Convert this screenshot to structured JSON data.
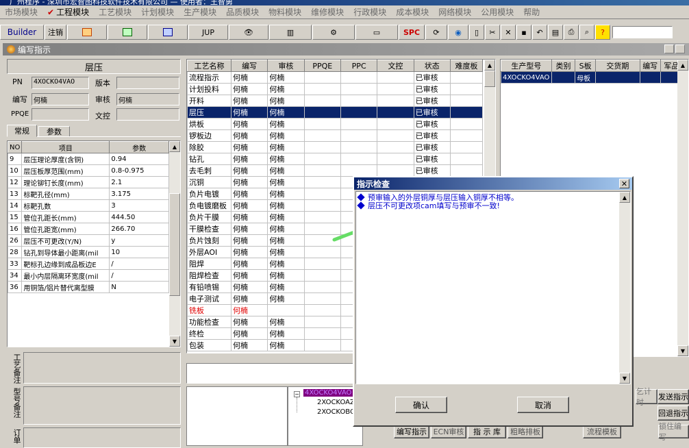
{
  "window_title": "广州程序 - 深圳市宏智图科技软件技术有限公司 — 使用者：王智勇",
  "menu": [
    {
      "label": "市场模块",
      "active": false
    },
    {
      "label": "工程模块",
      "active": true
    },
    {
      "label": "工艺模块",
      "active": false
    },
    {
      "label": "计划模块",
      "active": false
    },
    {
      "label": "生产模块",
      "active": false
    },
    {
      "label": "品质模块",
      "active": false
    },
    {
      "label": "物料模块",
      "active": false
    },
    {
      "label": "维修模块",
      "active": false
    },
    {
      "label": "行政模块",
      "active": false
    },
    {
      "label": "成本模块",
      "active": false
    },
    {
      "label": "网络模块",
      "active": false
    },
    {
      "label": "公用模块",
      "active": false
    },
    {
      "label": "帮助",
      "active": false
    }
  ],
  "toolbar": {
    "builder": "Builder",
    "logout": "注销",
    "jup": "JUP",
    "spc": "SPC"
  },
  "subwindow_title": "编写指示",
  "left": {
    "section_title": "层压",
    "pn_label": "PN",
    "pn_value": "4XOCKO4VAO",
    "version_label": "版本",
    "version_value": "",
    "author_label": "编写",
    "author_value": "何楠",
    "review_label": "审核",
    "review_value": "何楠",
    "ppqe_label": "PPQE",
    "ppqe_value": "",
    "doc_label": "文控",
    "doc_value": "",
    "tab_general": "常规",
    "tab_params": "参数",
    "param_headers": [
      "NO",
      "项目",
      "参数"
    ],
    "params": [
      [
        "9",
        "层压理论厚度(含铜)",
        "0.94"
      ],
      [
        "10",
        "层压板厚范围(mm)",
        "0.8-0.975"
      ],
      [
        "12",
        "理论铆钉长度(mm)",
        "2.1"
      ],
      [
        "13",
        "标靶孔径(mm)",
        "3.175"
      ],
      [
        "14",
        "标靶孔数",
        "3"
      ],
      [
        "15",
        "管位孔距长(mm)",
        "444.50"
      ],
      [
        "16",
        "管位孔距宽(mm)",
        "266.70"
      ],
      [
        "26",
        "层压不可更改(Y/N)",
        "y"
      ],
      [
        "28",
        "钻孔到导体最小距离(mil",
        "10"
      ],
      [
        "33",
        "靶标孔边缘到成品板边E",
        "/"
      ],
      [
        "34",
        "最小内层隔离环宽度(mil",
        "/"
      ],
      [
        "36",
        "用铜箔/铝片替代离型膜",
        "N"
      ]
    ],
    "notes": [
      "工艺备注",
      "型号备注",
      "订单"
    ]
  },
  "process": {
    "headers": [
      "工艺名称",
      "编写",
      "审核",
      "PPQE",
      "PPC",
      "文控",
      "状态",
      "难度板"
    ],
    "rows": [
      [
        "流程指示",
        "何楠",
        "何楠",
        "",
        "",
        "",
        "已审核",
        ""
      ],
      [
        "计划投料",
        "何楠",
        "何楠",
        "",
        "",
        "",
        "已审核",
        ""
      ],
      [
        "开料",
        "何楠",
        "何楠",
        "",
        "",
        "",
        "已审核",
        ""
      ],
      [
        "层压",
        "何楠",
        "何楠",
        "",
        "",
        "",
        "已审核",
        ""
      ],
      [
        "烘板",
        "何楠",
        "何楠",
        "",
        "",
        "",
        "已审核",
        ""
      ],
      [
        "锣板边",
        "何楠",
        "何楠",
        "",
        "",
        "",
        "已审核",
        ""
      ],
      [
        "除胶",
        "何楠",
        "何楠",
        "",
        "",
        "",
        "已审核",
        ""
      ],
      [
        "钻孔",
        "何楠",
        "何楠",
        "",
        "",
        "",
        "已审核",
        ""
      ],
      [
        "去毛刺",
        "何楠",
        "何楠",
        "",
        "",
        "",
        "已审核",
        ""
      ],
      [
        "沉铜",
        "何楠",
        "何楠",
        "",
        "",
        "",
        "",
        ""
      ],
      [
        "负片电镀",
        "何楠",
        "何楠",
        "",
        "",
        "",
        "",
        ""
      ],
      [
        "负电镀磨板",
        "何楠",
        "何楠",
        "",
        "",
        "",
        "",
        ""
      ],
      [
        "负片干膜",
        "何楠",
        "何楠",
        "",
        "",
        "",
        "",
        ""
      ],
      [
        "干膜检查",
        "何楠",
        "何楠",
        "",
        "",
        "",
        "",
        ""
      ],
      [
        "负片蚀刻",
        "何楠",
        "何楠",
        "",
        "",
        "",
        "",
        ""
      ],
      [
        "外层AOI",
        "何楠",
        "何楠",
        "",
        "",
        "",
        "",
        ""
      ],
      [
        "阻焊",
        "何楠",
        "何楠",
        "",
        "",
        "",
        "",
        ""
      ],
      [
        "阻焊检查",
        "何楠",
        "何楠",
        "",
        "",
        "",
        "",
        ""
      ],
      [
        "有铅喷锡",
        "何楠",
        "何楠",
        "",
        "",
        "",
        "",
        ""
      ],
      [
        "电子测试",
        "何楠",
        "何楠",
        "",
        "",
        "",
        "",
        ""
      ],
      [
        "铣板",
        "何楠",
        "",
        "",
        "",
        "",
        "",
        ""
      ],
      [
        "功能检查",
        "何楠",
        "何楠",
        "",
        "",
        "",
        "",
        ""
      ],
      [
        "终检",
        "何楠",
        "何楠",
        "",
        "",
        "",
        "",
        ""
      ],
      [
        "包装",
        "何楠",
        "何楠",
        "",
        "",
        "",
        "",
        ""
      ]
    ],
    "selected_index": 3,
    "red_index": 20
  },
  "right_table": {
    "headers": [
      "生产型号",
      "类别",
      "S板",
      "交货期",
      "编写",
      "军品"
    ],
    "rows": [
      [
        "4XOCKO4VAO",
        "",
        "母板",
        "",
        "",
        ""
      ]
    ]
  },
  "tree": {
    "root": "4XOCKO4VAO",
    "children": [
      "2XOCKOAZA",
      "2XOCKOBOA"
    ]
  },
  "bottom_buttons": {
    "row1": [
      "编写指示",
      "ECN审核",
      "指 示 库",
      "粗略排板",
      "",
      "流程模板",
      "",
      ""
    ],
    "partial": [
      "乞计时",
      "发送指示",
      "回退指示",
      "锁住编写"
    ]
  },
  "dialog": {
    "title": "指示检查",
    "messages": [
      "预审输入的外层铜厚与层压输入铜厚不相等。",
      "层压不可更改项cam填写与预审不一致!"
    ],
    "ok": "确认",
    "cancel": "取消"
  },
  "colors": {
    "selection": "#0a246a",
    "message": "#0000cc",
    "arrow": "#66dd66"
  }
}
